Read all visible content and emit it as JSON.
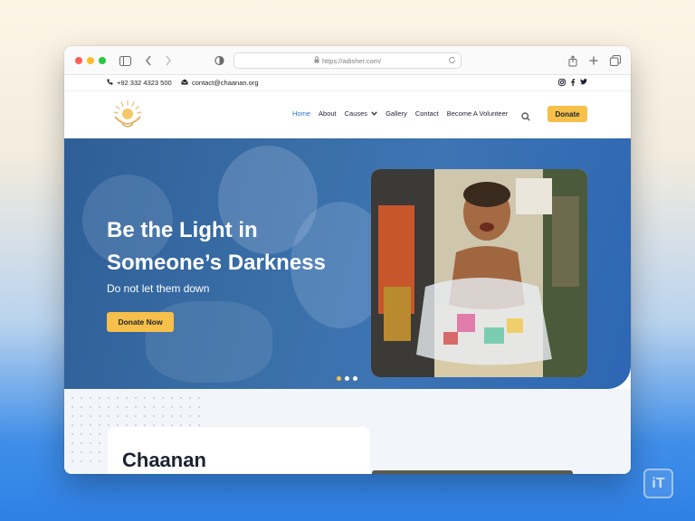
{
  "browser": {
    "url": "https://adisher.com/",
    "icons": [
      "sidebar-icon",
      "back-icon",
      "forward-icon",
      "privacy-shield-icon",
      "lock-icon",
      "reload-icon",
      "share-icon",
      "new-tab-icon",
      "tabs-overview-icon"
    ]
  },
  "topbar": {
    "phone": "+92 332 4323 500",
    "email": "contact@chaanan.org",
    "social_icons": [
      "instagram-icon",
      "facebook-icon",
      "twitter-icon"
    ]
  },
  "nav": {
    "items": [
      {
        "label": "Home",
        "active": true
      },
      {
        "label": "About"
      },
      {
        "label": "Causes",
        "has_dropdown": true
      },
      {
        "label": "Gallery"
      },
      {
        "label": "Contact"
      },
      {
        "label": "Become A Volunteer"
      }
    ],
    "donate_label": "Donate"
  },
  "hero": {
    "title_line1": "Be the Light in",
    "title_line2": "Someone’s Darkness",
    "subtitle": "Do not let them down",
    "cta_label": "Donate Now",
    "active_slide": 1,
    "slide_count": 3
  },
  "about": {
    "title": "Chaanan"
  },
  "watermark": "iT",
  "colors": {
    "accent_yellow": "#f7c04a",
    "hero_blue": "#3a6fa8",
    "nav_active": "#2b72c8"
  }
}
